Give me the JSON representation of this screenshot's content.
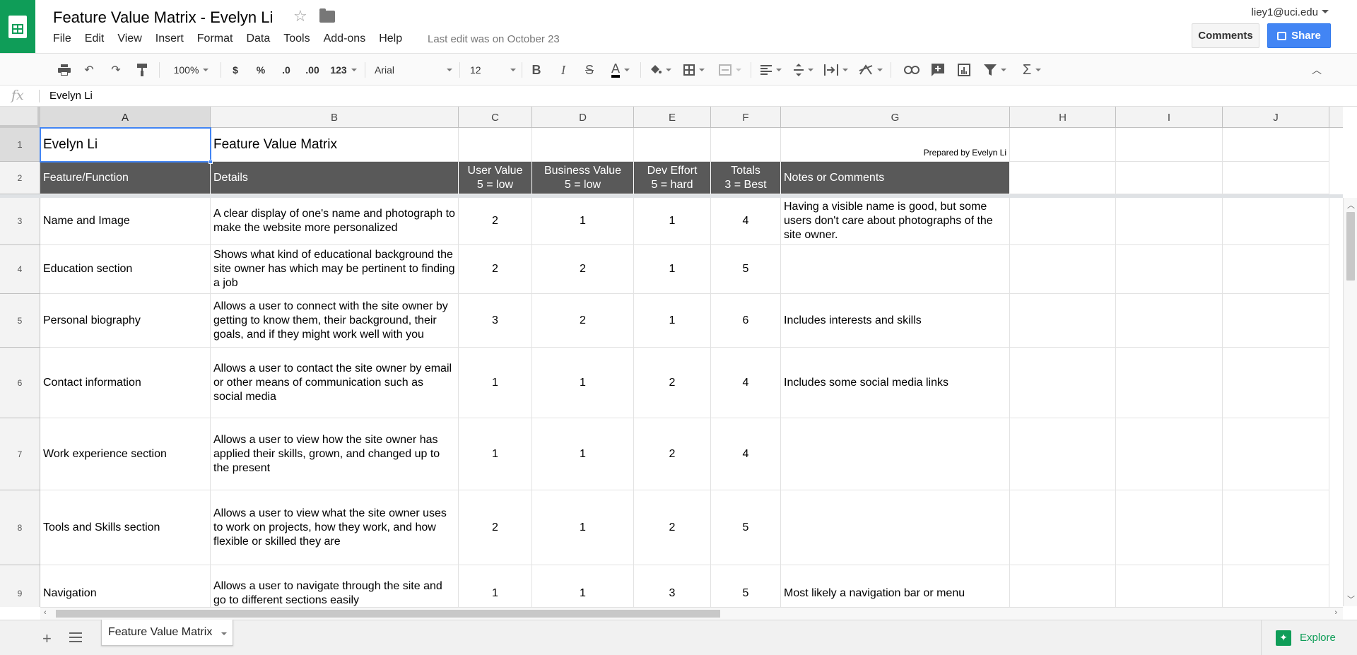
{
  "header": {
    "doc_title": "Feature Value Matrix - Evelyn Li",
    "menu": [
      "File",
      "Edit",
      "View",
      "Insert",
      "Format",
      "Data",
      "Tools",
      "Add-ons",
      "Help"
    ],
    "last_edit": "Last edit was on October 23",
    "user_email": "liey1@uci.edu",
    "comments_label": "Comments",
    "share_label": "Share"
  },
  "toolbar": {
    "zoom": "100%",
    "currency": "$",
    "percent": "%",
    "dec_less": ".0",
    "dec_more": ".00",
    "more_formats": "123",
    "font": "Arial",
    "font_size": "12",
    "bold": "B",
    "italic": "I",
    "strike": "S",
    "text_color": "A"
  },
  "formula_bar": {
    "fx": "fx",
    "value": "Evelyn Li"
  },
  "columns": [
    "A",
    "B",
    "C",
    "D",
    "E",
    "F",
    "G",
    "H",
    "I",
    "J"
  ],
  "rows": [
    {
      "num": "1",
      "a": "Evelyn Li",
      "b": "Feature Value Matrix",
      "c": "",
      "d": "",
      "e": "",
      "f": "",
      "g": "Prepared by Evelyn Li"
    },
    {
      "num": "2",
      "a": "Feature/Function",
      "b": "Details",
      "c": "User Value\n5 = low",
      "d": "Business Value\n5 = low",
      "e": "Dev Effort\n5 = hard",
      "f": "Totals\n3 = Best",
      "g": "Notes or Comments"
    },
    {
      "num": "3",
      "a": "Name and Image",
      "b": "A clear display of one's name and photograph to make the website more personalized",
      "c": "2",
      "d": "1",
      "e": "1",
      "f": "4",
      "g": "Having a visible name is good, but some users don't care about photographs of the site owner."
    },
    {
      "num": "4",
      "a": "Education section",
      "b": "Shows what kind of educational background the site owner has which may be pertinent to finding a job",
      "c": "2",
      "d": "2",
      "e": "1",
      "f": "5",
      "g": ""
    },
    {
      "num": "5",
      "a": "Personal biography",
      "b": "Allows a user to connect with the site owner by getting to know them, their background, their goals, and if they might work well with you",
      "c": "3",
      "d": "2",
      "e": "1",
      "f": "6",
      "g": "Includes interests and skills"
    },
    {
      "num": "6",
      "a": "Contact information",
      "b": "Allows a user to contact the site owner by email or other means of communication such as social media",
      "c": "1",
      "d": "1",
      "e": "2",
      "f": "4",
      "g": "Includes some social media links"
    },
    {
      "num": "7",
      "a": "Work experience section",
      "b": "Allows a user to view how the site owner has applied their skills, grown, and changed up to the present",
      "c": "1",
      "d": "1",
      "e": "2",
      "f": "4",
      "g": ""
    },
    {
      "num": "8",
      "a": "Tools and Skills section",
      "b": "Allows a user to view what the site owner uses to work on projects, how they work, and how flexible or skilled they are",
      "c": "2",
      "d": "1",
      "e": "2",
      "f": "5",
      "g": ""
    },
    {
      "num": "9",
      "a": "Navigation",
      "b": "Allows a user to navigate through the site and go to different sections easily",
      "c": "1",
      "d": "1",
      "e": "3",
      "f": "5",
      "g": "Most likely a navigation bar or menu"
    }
  ],
  "sheet_tab": "Feature Value Matrix",
  "explore_label": "Explore",
  "colors": {
    "header_fill": "#595959",
    "brand_green": "#0f9d58",
    "share_blue": "#4285f4",
    "selection": "#4285f4"
  }
}
